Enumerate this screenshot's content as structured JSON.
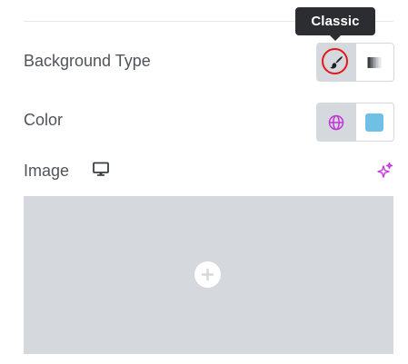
{
  "tooltip": {
    "text": "Classic"
  },
  "background_type": {
    "label": "Background Type",
    "options": [
      {
        "name": "Classic",
        "icon": "paint-brush-icon",
        "active": true
      },
      {
        "name": "Gradient",
        "icon": "gradient-icon",
        "active": false
      }
    ]
  },
  "color": {
    "label": "Color",
    "global_icon": "globe-icon",
    "swatch_color": "#6ec1e4"
  },
  "image": {
    "label": "Image",
    "responsive_icon": "desktop-monitor-icon",
    "ai_icon": "sparkle-icon",
    "placeholder_icon": "plus-icon"
  },
  "colors": {
    "accent": "#c036d9",
    "highlight_ring": "#e11b1b",
    "control_bg": "#d5d8dc"
  }
}
